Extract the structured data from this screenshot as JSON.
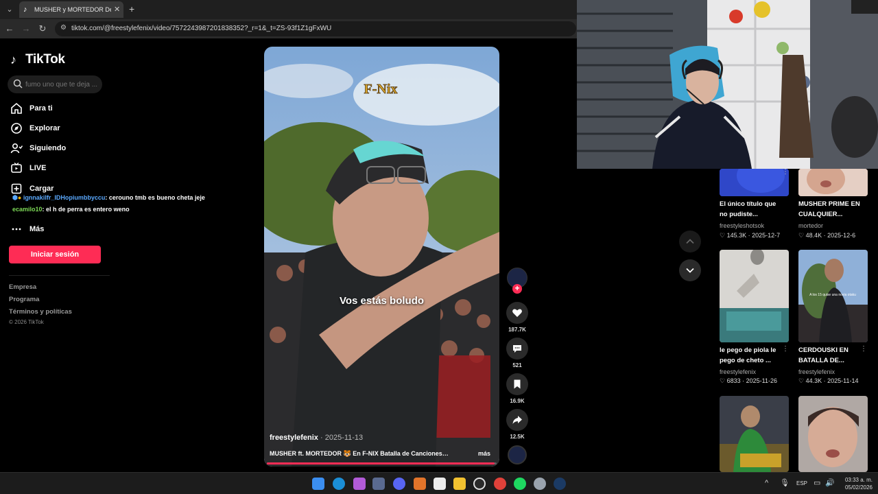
{
  "browser": {
    "tab_title": "MUSHER y MORTEDOR Desluml",
    "url": "tiktok.com/@freestylefenix/video/7572243987201838352?_r=1&_t=ZS-93f1Z1gFxWU"
  },
  "sidebar": {
    "logo": "TikTok",
    "search_placeholder": "fumo uno que te deja ...",
    "items": [
      {
        "label": "Para ti",
        "icon": "home-icon"
      },
      {
        "label": "Explorar",
        "icon": "compass-icon"
      },
      {
        "label": "Siguiendo",
        "icon": "following-icon"
      },
      {
        "label": "LIVE",
        "icon": "live-icon"
      },
      {
        "label": "Cargar",
        "icon": "upload-icon"
      },
      {
        "label": "Más",
        "icon": "more-icon"
      }
    ],
    "login_button": "Iniciar sesión",
    "footer": [
      "Empresa",
      "Programa",
      "Términos y políticas"
    ],
    "copyright": "© 2026 TikTok"
  },
  "chat_overlay": [
    {
      "user": "ignnakilfr_IDHopiumbbyccu",
      "message": ": cerouno tmb es bueno cheta jeje"
    },
    {
      "user": "ecamilo10",
      "message": ": el h de perra es entero weno"
    }
  ],
  "video": {
    "caption_overlay": "Vos estás boludo",
    "author": "freestylefenix",
    "date": "· 2025-11-13",
    "description": "MUSHER ft. MORTEDOR 🐯 En F-NIX Batalla de Canciones, ...",
    "more": "más",
    "progress": 0.99
  },
  "actions": {
    "likes": "187.7K",
    "comments": "521",
    "saves": "16.9K",
    "shares": "12.5K"
  },
  "grid": [
    {
      "title": "El único título que no pudiste...",
      "author": "freestyleshotsok",
      "likes": "145.3K",
      "date": "2025-12-7"
    },
    {
      "title": "MUSHER PRIME EN CUALQUIER...",
      "author": "mortedor",
      "likes": "48.4K",
      "date": "2025-12-6"
    },
    {
      "title": "le pego de piola le pego de cheto ...",
      "author": "freestylefenix",
      "likes": "6833",
      "date": "2025-11-26"
    },
    {
      "title": "CERDOUSKI EN BATALLA DE...",
      "author": "freestylefenix",
      "likes": "44.3K",
      "date": "2025-11-14"
    }
  ],
  "thumb_text": "A los 15 quise una novia otaku",
  "taskbar": {
    "lang": "ESP",
    "time": "03:33 a. m.",
    "date": "05/02/2026"
  },
  "colors": {
    "accent": "#fe2c55",
    "bg": "#000000"
  }
}
